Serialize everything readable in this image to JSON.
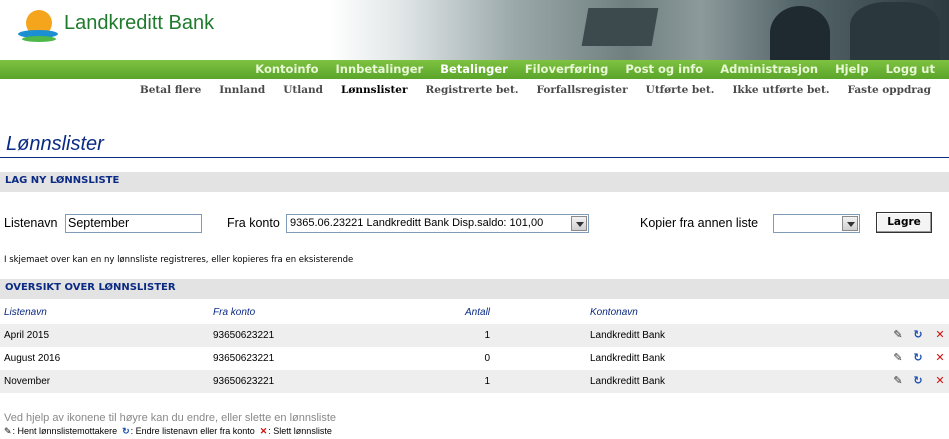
{
  "brand": {
    "name": "Landkreditt Bank"
  },
  "main_nav": [
    {
      "label": "Kontoinfo",
      "active": false
    },
    {
      "label": "Innbetalinger",
      "active": false
    },
    {
      "label": "Betalinger",
      "active": true
    },
    {
      "label": "Filoverføring",
      "active": false
    },
    {
      "label": "Post og info",
      "active": false
    },
    {
      "label": "Administrasjon",
      "active": false
    },
    {
      "label": "Hjelp",
      "active": false
    },
    {
      "label": "Logg ut",
      "active": false
    }
  ],
  "sub_nav": [
    {
      "label": "Betal flere",
      "active": false
    },
    {
      "label": "Innland",
      "active": false
    },
    {
      "label": "Utland",
      "active": false
    },
    {
      "label": "Lønnslister",
      "active": true
    },
    {
      "label": "Registrerte bet.",
      "active": false
    },
    {
      "label": "Forfallsregister",
      "active": false
    },
    {
      "label": "Utførte bet.",
      "active": false
    },
    {
      "label": "Ikke utførte bet.",
      "active": false
    },
    {
      "label": "Faste oppdrag",
      "active": false
    }
  ],
  "page": {
    "title": "Lønnslister"
  },
  "new_list": {
    "section_title": "LAG NY LØNNSLISTE",
    "listenavn_label": "Listenavn",
    "listenavn_value": "September",
    "fra_konto_label": "Fra konto",
    "fra_konto_value": "9365.06.23221 Landkreditt Bank Disp.saldo: 101,00",
    "kopier_label": "Kopier fra annen liste",
    "kopier_value": "",
    "save_label": "Lagre",
    "info": "I skjemaet over kan en ny lønnsliste registreres, eller kopieres fra en eksisterende"
  },
  "overview": {
    "section_title": "OVERSIKT OVER LØNNSLISTER",
    "columns": {
      "listenavn": "Listenavn",
      "fra_konto": "Fra konto",
      "antall": "Antall",
      "kontonavn": "Kontonavn"
    },
    "rows": [
      {
        "listenavn": "April 2015",
        "fra_konto": "93650623221",
        "antall": "1",
        "kontonavn": "Landkreditt Bank"
      },
      {
        "listenavn": "August 2016",
        "fra_konto": "93650623221",
        "antall": "0",
        "kontonavn": "Landkreditt Bank"
      },
      {
        "listenavn": "November",
        "fra_konto": "93650623221",
        "antall": "1",
        "kontonavn": "Landkreditt Bank"
      }
    ]
  },
  "footer": {
    "help_text": "Ved hjelp av ikonene til høyre kan du endre, eller slette en lønnsliste",
    "legend_fetch": ": Hent lønnslistemottakere",
    "legend_edit": ": Endre listenavn eller fra konto",
    "legend_delete": ": Slett lønnsliste"
  },
  "icons": {
    "row_action_1": "fetch-recipients-icon",
    "row_action_2": "refresh-icon",
    "row_action_3": "delete-icon"
  },
  "colors": {
    "nav_green": "#5aa52a",
    "heading_blue": "#0b2a84",
    "delete_red": "#d21010"
  }
}
